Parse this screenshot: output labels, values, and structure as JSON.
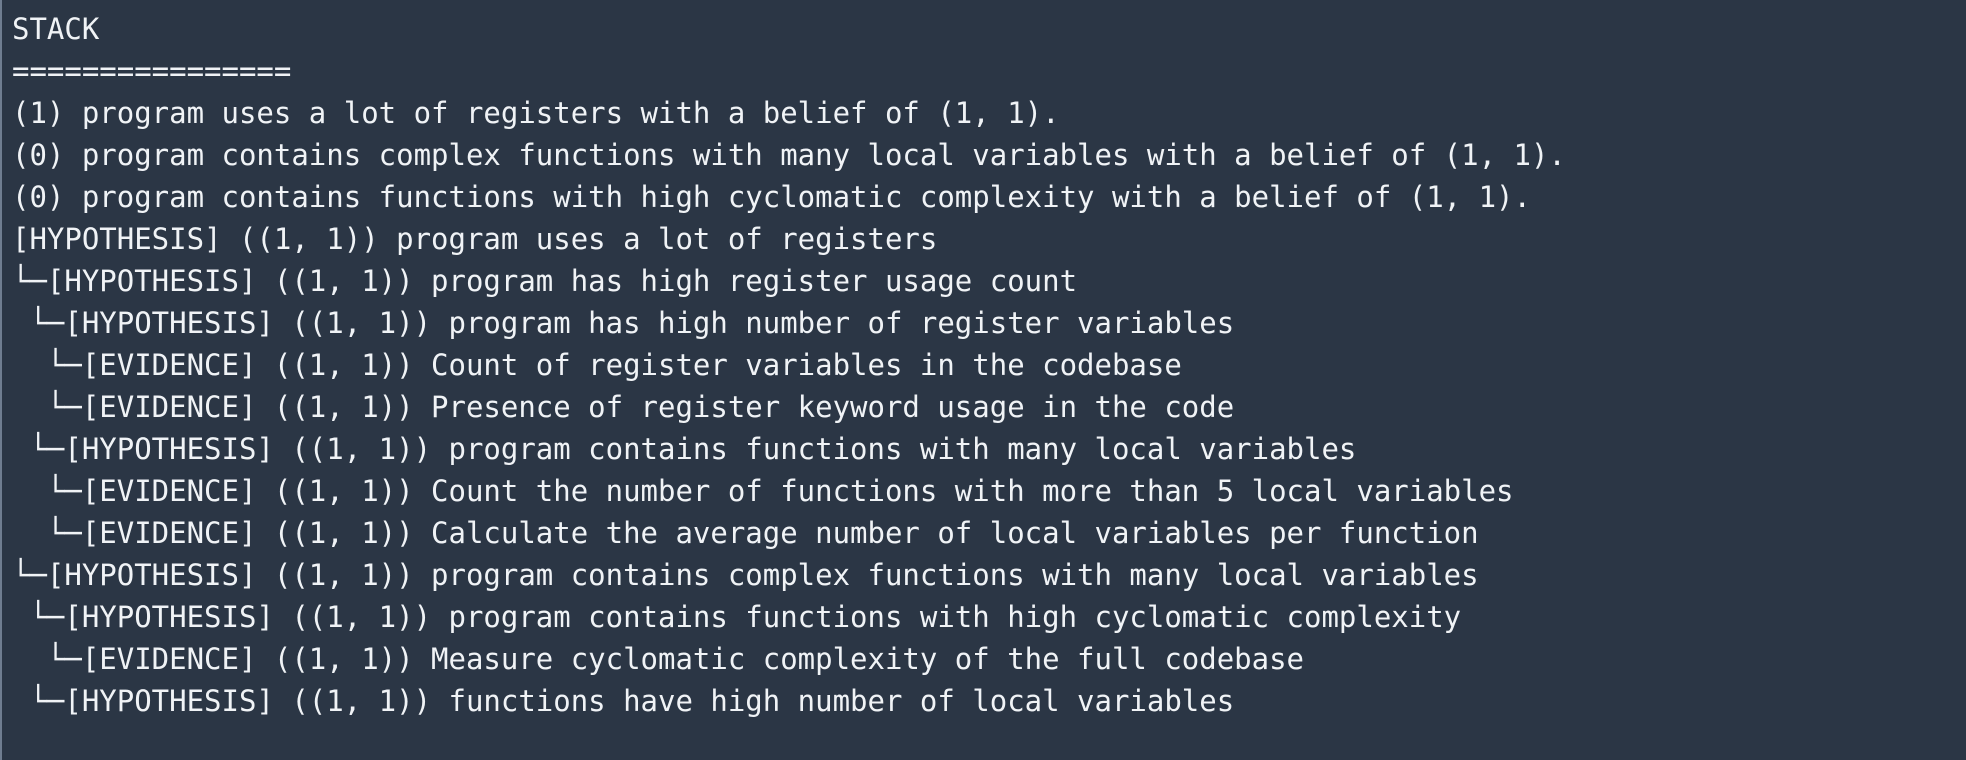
{
  "terminal": {
    "title": "STACK",
    "separator": "================",
    "lines": [
      "(1) program uses a lot of registers with a belief of (1, 1).",
      "(0) program contains complex functions with many local variables with a belief of (1, 1).",
      "(0) program contains functions with high cyclomatic complexity with a belief of (1, 1).",
      "[HYPOTHESIS] ((1, 1)) program uses a lot of registers",
      "└─[HYPOTHESIS] ((1, 1)) program has high register usage count",
      " └─[HYPOTHESIS] ((1, 1)) program has high number of register variables",
      "  └─[EVIDENCE] ((1, 1)) Count of register variables in the codebase",
      "  └─[EVIDENCE] ((1, 1)) Presence of register keyword usage in the code",
      " └─[HYPOTHESIS] ((1, 1)) program contains functions with many local variables",
      "  └─[EVIDENCE] ((1, 1)) Count the number of functions with more than 5 local variables",
      "  └─[EVIDENCE] ((1, 1)) Calculate the average number of local variables per function",
      "└─[HYPOTHESIS] ((1, 1)) program contains complex functions with many local variables",
      " └─[HYPOTHESIS] ((1, 1)) program contains functions with high cyclomatic complexity",
      "  └─[EVIDENCE] ((1, 1)) Measure cyclomatic complexity of the full codebase",
      " └─[HYPOTHESIS] ((1, 1)) functions have high number of local variables"
    ]
  }
}
